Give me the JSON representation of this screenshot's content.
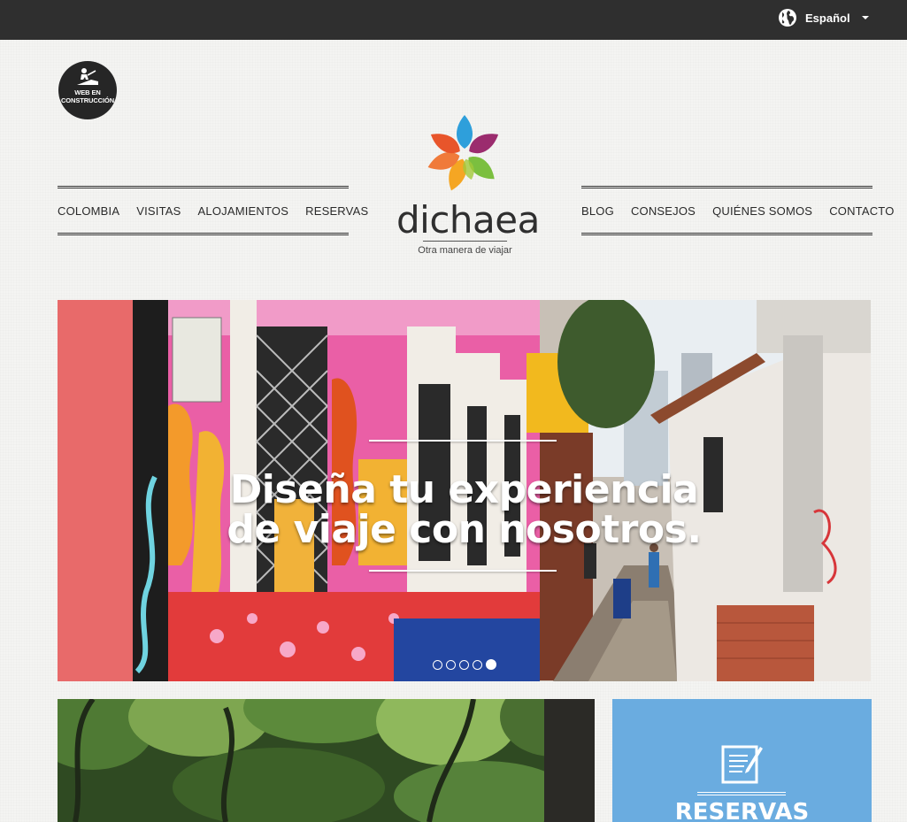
{
  "topbar": {
    "language_label": "Español",
    "icons": {
      "language": "globe-icon",
      "dropdown": "caret-down-icon"
    }
  },
  "badge": {
    "text": "WEB EN CONSTRUCCIÓN",
    "icon": "worker-digging-icon"
  },
  "nav_left": [
    {
      "label": "COLOMBIA"
    },
    {
      "label": "VISITAS"
    },
    {
      "label": "ALOJAMIENTOS"
    },
    {
      "label": "RESERVAS"
    }
  ],
  "nav_right": [
    {
      "label": "BLOG"
    },
    {
      "label": "CONSEJOS"
    },
    {
      "label": "QUIÉNES SOMOS"
    },
    {
      "label": "CONTACTO"
    }
  ],
  "logo": {
    "name": "dichaea",
    "tagline": "Otra manera de viajar",
    "petal_colors": [
      "#2e9fdb",
      "#9b2c6e",
      "#7bbf3f",
      "#f5a623",
      "#e8552b",
      "#f07a3a",
      "#a3c93a"
    ]
  },
  "hero": {
    "title_line1": "Diseña tu experiencia",
    "title_line2": "de viaje con nosotros.",
    "slides": 5,
    "active_slide": 5
  },
  "cards": {
    "reservas_label": "RESERVAS",
    "reservas_icon": "edit-document-icon",
    "reservas_color": "#6aace0"
  }
}
